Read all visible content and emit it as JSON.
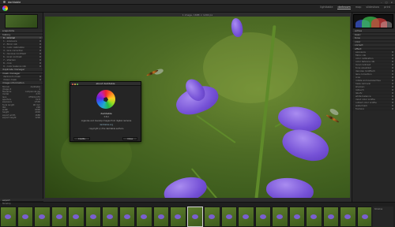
{
  "window": {
    "title": "darktable"
  },
  "views": {
    "items": [
      "lighttable",
      "darkroom",
      "map",
      "slideshow",
      "print"
    ],
    "active": "darkroom"
  },
  "center": {
    "status": "1 image, 1688 × 1200 px"
  },
  "left_panel": {
    "sections": [
      {
        "title": "snapshots",
        "rows": []
      },
      {
        "title": "history",
        "rows": [
          "0 - original",
          "1 - exposure",
          "2 - filmic rgb",
          "3 - color calibration",
          "4 - lens correction",
          "5 - denoise (profiled)",
          "6 - local contrast",
          "7 - sharpen",
          "8 - crop",
          "9 - color balance rgb"
        ]
      },
      {
        "title": "duplicate manager",
        "rows": []
      },
      {
        "title": "mask manager",
        "rows": [
          "darkroom mask",
          "drawn mask"
        ]
      },
      {
        "title": "image information",
        "rows": []
      }
    ],
    "meta": [
      [
        "filmroll",
        "darktable"
      ],
      [
        "image id",
        "1"
      ],
      [
        "filename",
        "campanula.jpg"
      ],
      [
        "model",
        "X-T2"
      ],
      [
        "lens",
        "XF90mmF2"
      ],
      [
        "aperture",
        "f/2.8"
      ],
      [
        "exposure",
        "1/500"
      ],
      [
        "focal length",
        "90 mm"
      ],
      [
        "ISO",
        "200"
      ],
      [
        "width",
        "6000"
      ],
      [
        "height",
        "4000"
      ],
      [
        "export width",
        "1688"
      ],
      [
        "export height",
        "1200"
      ]
    ],
    "footer": "export"
  },
  "right_panel": {
    "sections": [
      "active",
      "basic",
      "tone",
      "color",
      "correct",
      "effect",
      "exposure",
      "filmic rgb",
      "color calibration",
      "color balance rgb",
      "local contrast",
      "tone equalizer",
      "denoise (profiled)",
      "lens correction",
      "crop",
      "rotate and perspective",
      "haze removal",
      "sharpen",
      "retouch",
      "liquify",
      "white balance",
      "input color profile",
      "output color profile",
      "watermark",
      "framing"
    ]
  },
  "dialog": {
    "title": "about darktable",
    "app_name": "darktable",
    "version": "3.8.0",
    "description": "organize and develop images from digital cameras",
    "website": "darktable.org",
    "copyright": "copyright (c) the darktable authors",
    "btn_credits": "Credits",
    "btn_close": "Close"
  },
  "filmstrip": {
    "label": "filmstrip",
    "count": 24,
    "current_index": 11,
    "side_label": "timeline"
  },
  "colors": {
    "accent": "#7551d6",
    "panel": "#262626",
    "background": "#1b1b1b"
  }
}
